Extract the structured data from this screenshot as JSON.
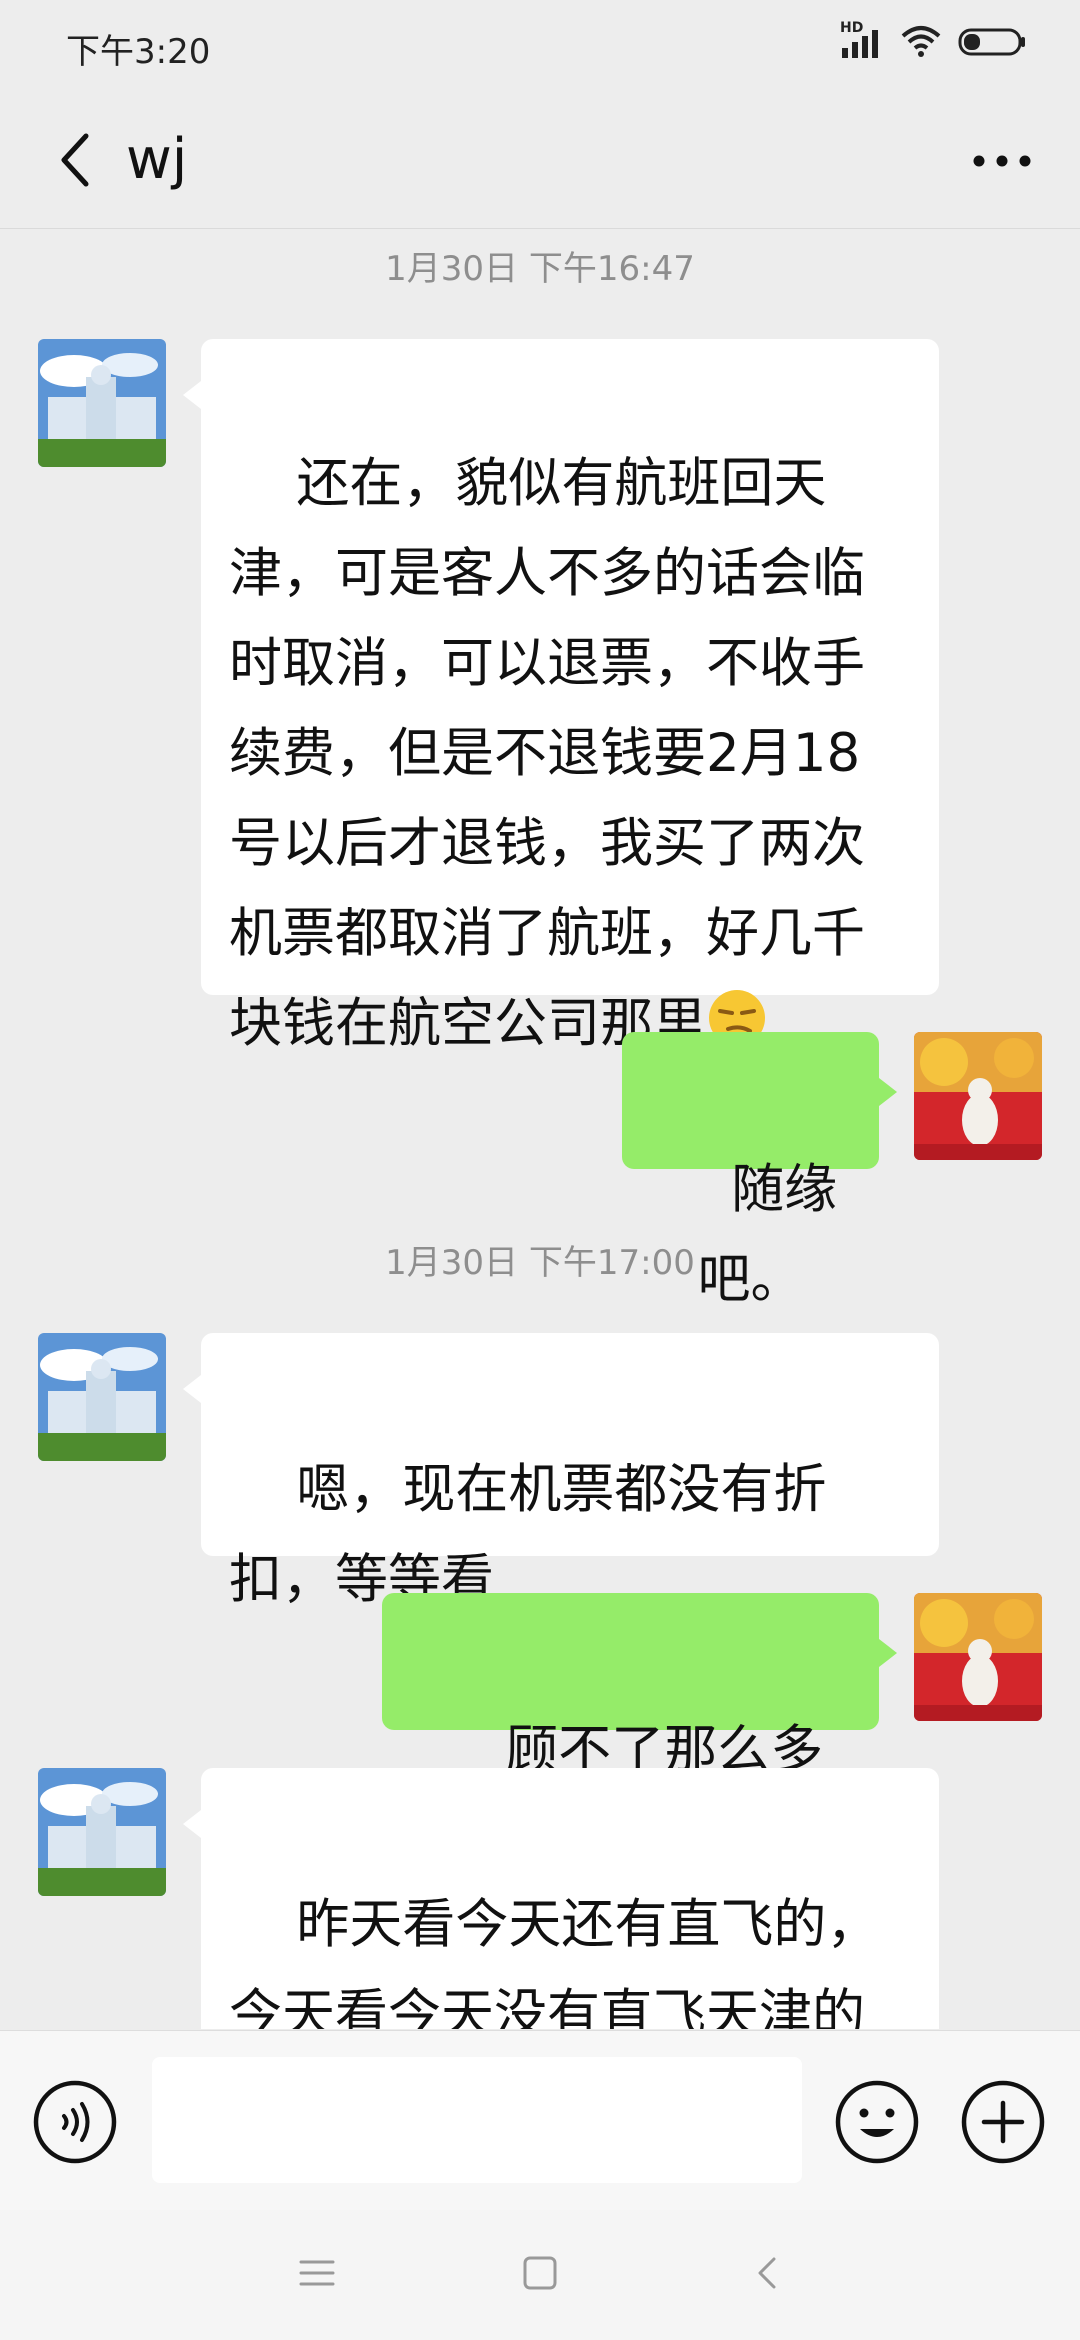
{
  "status": {
    "time": "下午3:20",
    "network_label": "HD",
    "icons": [
      "signal-icon",
      "wifi-icon",
      "battery-icon"
    ]
  },
  "header": {
    "contact": "wj",
    "back_icon": "chevron-left-icon",
    "more_icon": "more-dots-icon"
  },
  "messages": [
    {
      "type": "timestamp",
      "text": "1月30日 下午16:47"
    },
    {
      "type": "incoming",
      "text": "还在，貌似有航班回天津，可是客人不多的话会临时取消，可以退票，不收手续费，但是不退钱要2月18号以后才退钱，我买了两次机票都取消了航班，好几千块钱在航空公司那里",
      "emoji": "smirk-emoji"
    },
    {
      "type": "outgoing",
      "text": "随缘吧。"
    },
    {
      "type": "timestamp",
      "text": "1月30日 下午17:00"
    },
    {
      "type": "incoming",
      "text": "嗯，现在机票都没有折扣，等等看"
    },
    {
      "type": "outgoing",
      "text": "顾不了那么多了。"
    },
    {
      "type": "incoming",
      "text": "昨天看今天还有直飞的，今天看今天没有直飞天津的航班只有中转的"
    }
  ],
  "input": {
    "value": "",
    "placeholder": "",
    "voice_icon": "voice-icon",
    "emoji_icon": "emoji-icon",
    "plus_icon": "plus-icon"
  },
  "colors": {
    "background": "#EDEDED",
    "outgoing_bubble": "#95EC69",
    "incoming_bubble": "#FFFFFF",
    "timestamp_text": "#8E8E8E"
  },
  "navbar": {
    "icons": [
      "menu-icon",
      "home-square-icon",
      "back-triangle-icon"
    ]
  }
}
